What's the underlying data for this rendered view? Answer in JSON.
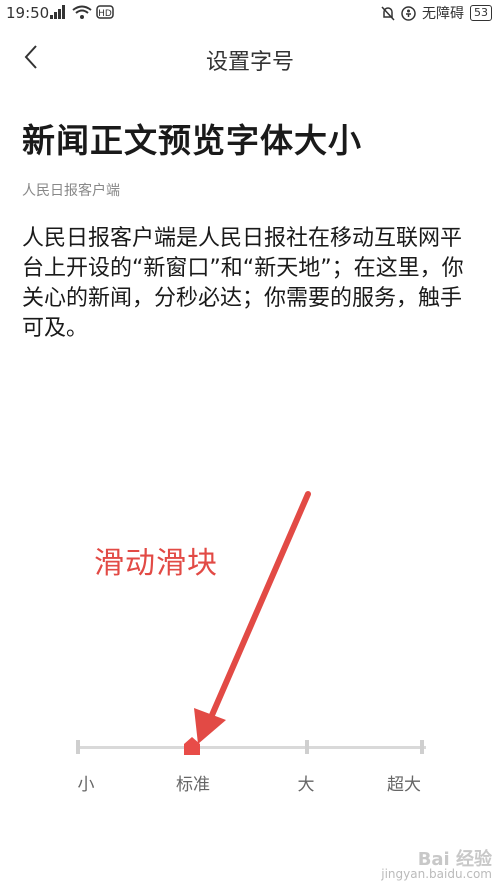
{
  "status_bar": {
    "time": "19:50",
    "accessibility_text": "无障碍",
    "battery": "53"
  },
  "header": {
    "title": "设置字号"
  },
  "preview": {
    "title": "新闻正文预览字体大小",
    "source": "人民日报客户端",
    "body": "人民日报客户端是人民日报社在移动互联网平台上开设的“新窗口”和“新天地”；在这里，你关心的新闻，分秒必达；你需要的服务，触手可及。"
  },
  "annotation": {
    "text": "滑动滑块",
    "color": "#e24a45"
  },
  "font_size_slider": {
    "options": [
      "小",
      "标准",
      "大",
      "超大"
    ],
    "selected": "标准",
    "selected_index": 1,
    "accent_color": "#e84c48"
  },
  "watermark": {
    "logo": "Bai 经验",
    "url": "jingyan.baidu.com"
  }
}
